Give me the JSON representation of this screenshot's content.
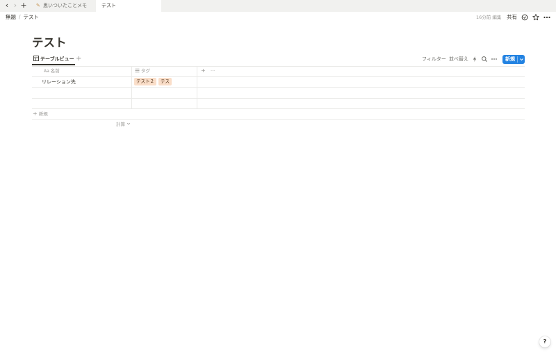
{
  "tabs": [
    {
      "label": "思いついたことメモ",
      "icon": "pencil-icon"
    },
    {
      "label": "テスト"
    }
  ],
  "header": {
    "breadcrumb": [
      "無題",
      "テスト"
    ],
    "breadcrumb_sep": "/",
    "edited": "16分前 編集",
    "share": "共有"
  },
  "page": {
    "title": "テスト"
  },
  "viewbar": {
    "view_label": "テーブルビュー",
    "add_view": "+",
    "filter": "フィルター",
    "sort": "並べ替え",
    "new_label": "新規"
  },
  "table": {
    "columns": [
      {
        "icon": "Aa",
        "label": "名前"
      },
      {
        "icon": "list-icon",
        "label": "タグ"
      }
    ],
    "add_column": "+",
    "more_columns": "···",
    "rows": [
      {
        "name": "リレーション先",
        "tags": [
          "テスト２",
          "テス"
        ]
      },
      {
        "name": "",
        "tags": []
      },
      {
        "name": "",
        "tags": []
      }
    ],
    "new_row": "新規",
    "calculate": "計算"
  },
  "help": "?",
  "colors": {
    "accent": "#2383e2",
    "tag_bg": "#fadec9",
    "text": "#37352f",
    "muted": "#9b9a97"
  }
}
